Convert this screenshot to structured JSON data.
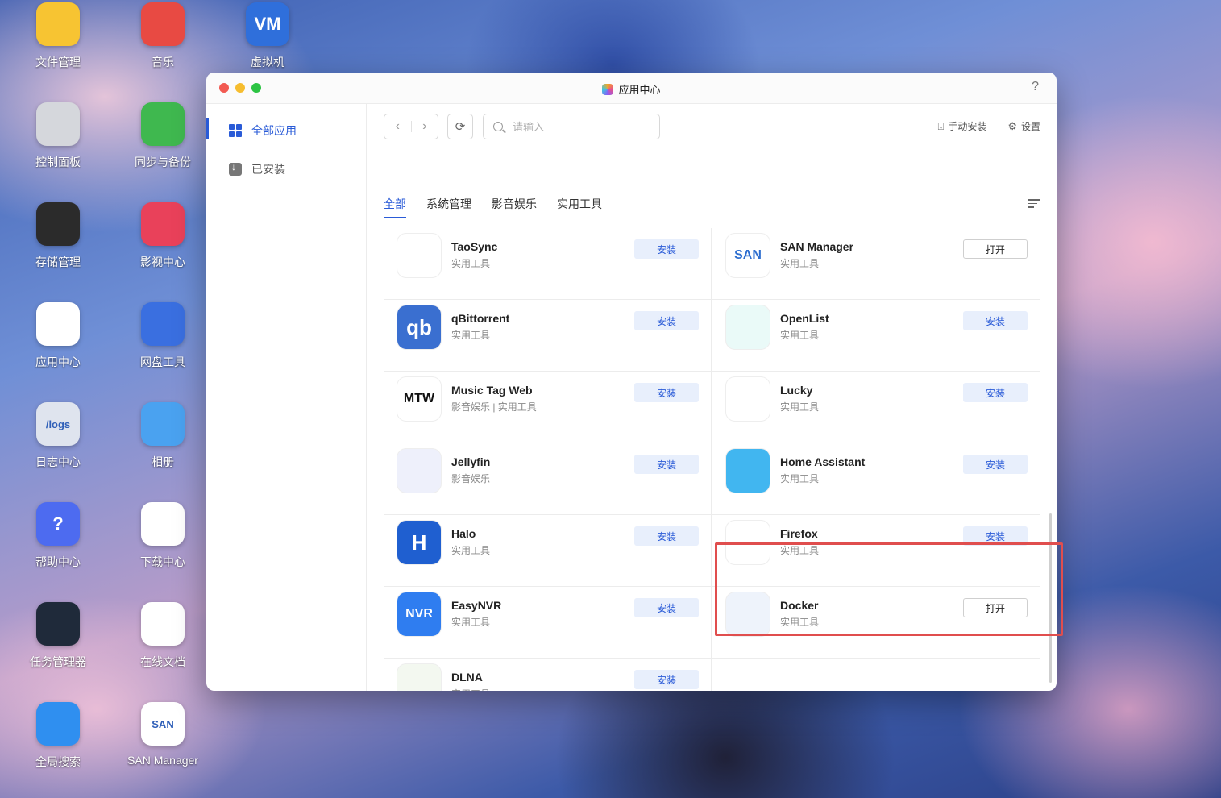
{
  "desktop": {
    "icons": [
      {
        "label": "文件管理",
        "icon": "folder-icon",
        "color": "#f7c432"
      },
      {
        "label": "音乐",
        "icon": "music-icon",
        "color": "#e84a43"
      },
      {
        "label": "虚拟机",
        "icon": "vm-icon",
        "color": "#2f6fdb",
        "glyph": "VM"
      },
      {
        "label": "控制面板",
        "icon": "sliders-icon",
        "color": "#d5d7dc"
      },
      {
        "label": "同步与备份",
        "icon": "sync-icon",
        "color": "#3fb84f"
      },
      {
        "label": "存储管理",
        "icon": "storage-icon",
        "color": "#2b2b2b"
      },
      {
        "label": "影视中心",
        "icon": "film-icon",
        "color": "#e9415a"
      },
      {
        "label": "应用中心",
        "icon": "app-center-icon",
        "color": "#ffffff"
      },
      {
        "label": "网盘工具",
        "icon": "cloud-drive-icon",
        "color": "#3a6fe0"
      },
      {
        "label": "日志中心",
        "icon": "logs-icon",
        "color": "#dfe4ee",
        "glyph": "/logs"
      },
      {
        "label": "相册",
        "icon": "photo-icon",
        "color": "#4aa2f0"
      },
      {
        "label": "帮助中心",
        "icon": "help-icon",
        "color": "#4d6bf0",
        "glyph": "?"
      },
      {
        "label": "下载中心",
        "icon": "download-icon",
        "color": "#ffffff"
      },
      {
        "label": "任务管理器",
        "icon": "task-manager-icon",
        "color": "#1f2a3a"
      },
      {
        "label": "在线文档",
        "icon": "document-icon",
        "color": "#ffffff"
      },
      {
        "label": "全局搜索",
        "icon": "search-icon",
        "color": "#2f8ff0"
      },
      {
        "label": "SAN Manager",
        "icon": "san-icon",
        "color": "#ffffff",
        "glyph": "SAN"
      }
    ]
  },
  "window": {
    "title": "应用中心",
    "help": "?"
  },
  "sidebar": {
    "items": [
      {
        "label": "全部应用",
        "active": true
      },
      {
        "label": "已安装",
        "active": false
      }
    ]
  },
  "toolbar": {
    "back": "‹",
    "forward": "›",
    "refresh": "⟳",
    "search_placeholder": "请输入",
    "manual_install": "手动安装",
    "settings": "设置"
  },
  "tabs": [
    "全部",
    "系统管理",
    "影音娱乐",
    "实用工具"
  ],
  "apps_left": [
    {
      "name": "TaoSync",
      "category": "实用工具",
      "button": "安装",
      "state": "install",
      "icon": "taosync-icon",
      "color": "#ffffff"
    },
    {
      "name": "qBittorrent",
      "category": "实用工具",
      "button": "安装",
      "state": "install",
      "icon": "qbittorrent-icon",
      "color": "#3a6fd0",
      "glyph": "qb"
    },
    {
      "name": "Music Tag Web",
      "category": "影音娱乐 | 实用工具",
      "button": "安装",
      "state": "install",
      "icon": "music-tag-web-icon",
      "color": "#ffffff",
      "glyph": "MTW"
    },
    {
      "name": "Jellyfin",
      "category": "影音娱乐",
      "button": "安装",
      "state": "install",
      "icon": "jellyfin-icon",
      "color": "#eef0fb"
    },
    {
      "name": "Halo",
      "category": "实用工具",
      "button": "安装",
      "state": "install",
      "icon": "halo-icon",
      "color": "#1f5fd0",
      "glyph": "H"
    },
    {
      "name": "EasyNVR",
      "category": "实用工具",
      "button": "安装",
      "state": "install",
      "icon": "easynvr-icon",
      "color": "#2f7df0",
      "glyph": "NVR"
    },
    {
      "name": "DLNA",
      "category": "实用工具",
      "button": "安装",
      "state": "install",
      "icon": "dlna-icon",
      "color": "#f3f8f0"
    }
  ],
  "apps_right": [
    {
      "name": "SAN Manager",
      "category": "实用工具",
      "button": "打开",
      "state": "open",
      "icon": "san-manager-icon",
      "color": "#ffffff",
      "glyph": "SAN"
    },
    {
      "name": "OpenList",
      "category": "实用工具",
      "button": "安装",
      "state": "install",
      "icon": "openlist-icon",
      "color": "#eafaf8"
    },
    {
      "name": "Lucky",
      "category": "实用工具",
      "button": "安装",
      "state": "install",
      "icon": "lucky-icon",
      "color": "#ffffff"
    },
    {
      "name": "Home Assistant",
      "category": "实用工具",
      "button": "安装",
      "state": "install",
      "icon": "home-assistant-icon",
      "color": "#41b6f0"
    },
    {
      "name": "Firefox",
      "category": "实用工具",
      "button": "安装",
      "state": "install",
      "icon": "firefox-icon",
      "color": "#ffffff"
    },
    {
      "name": "Docker",
      "category": "实用工具",
      "button": "打开",
      "state": "open",
      "icon": "docker-icon",
      "color": "#eef3fb"
    }
  ],
  "colors": {
    "accent": "#2a5bd7",
    "install_bg": "#e8effc",
    "highlight": "#e04e4e"
  }
}
